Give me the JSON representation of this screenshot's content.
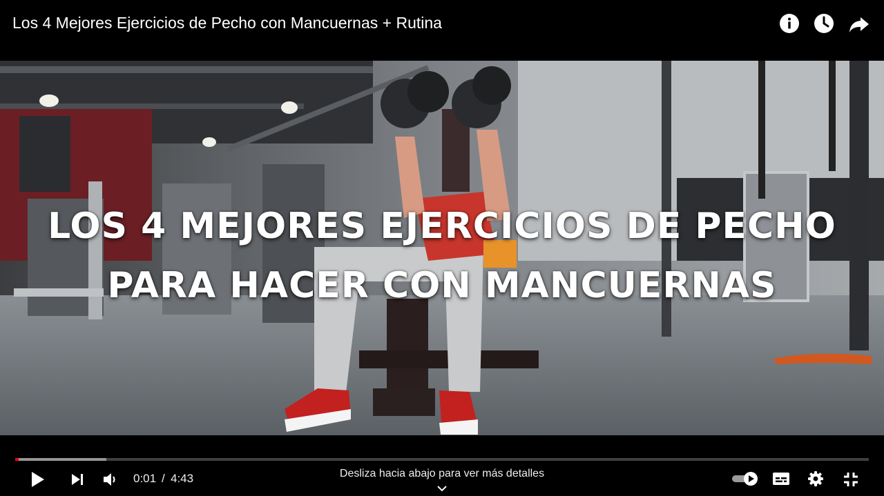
{
  "header": {
    "title": "Los 4 Mejores Ejercicios de Pecho con Mancuernas + Rutina",
    "icons": [
      "info-icon",
      "watch-later-icon",
      "share-icon"
    ]
  },
  "video": {
    "overlay_line1": "LOS 4 MEJORES EJERCICIOS DE PECHO",
    "overlay_line2": "PARA HACER CON MANCUERNAS"
  },
  "player": {
    "time_current": "0:01",
    "time_separator": "/",
    "time_total": "4:43",
    "progress_played_fraction": 0.002,
    "progress_buffered_fraction": 0.107,
    "swipe_hint": "Desliza hacia abajo para ver más detalles",
    "icons": [
      "play-icon",
      "next-icon",
      "volume-icon",
      "autoplay-toggle-icon",
      "subtitles-icon",
      "settings-icon",
      "exit-fullscreen-icon"
    ],
    "accent_color": "#ff0000"
  }
}
